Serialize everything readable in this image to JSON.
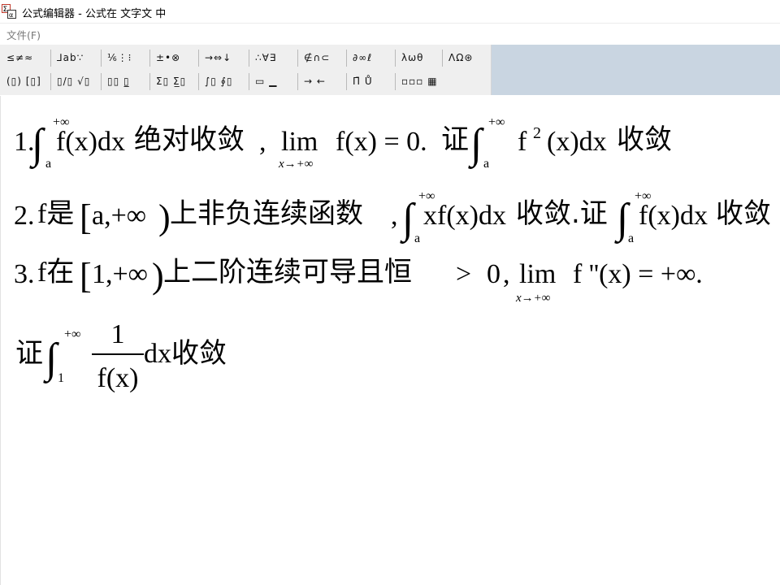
{
  "window": {
    "title": "公式编辑器 - 公式在 文字文 中"
  },
  "menu": {
    "file_label": "文件(F)"
  },
  "toolbar": {
    "row1": [
      {
        "name": "relations-palette-button",
        "label": "≤≠≈"
      },
      {
        "name": "spaces-palette-button",
        "label": "⅃ab∵"
      },
      {
        "name": "embellishments-palette-button",
        "label": "⅙⋮⁝"
      },
      {
        "name": "operators-palette-button",
        "label": "±•⊗"
      },
      {
        "name": "arrows-palette-button",
        "label": "→⇔↓"
      },
      {
        "name": "logic-palette-button",
        "label": "∴∀∃"
      },
      {
        "name": "sets-palette-button",
        "label": "∉∩⊂"
      },
      {
        "name": "misc-symbols-palette-button",
        "label": "∂∞ℓ"
      },
      {
        "name": "greek-lower-palette-button",
        "label": "λωθ"
      },
      {
        "name": "greek-upper-palette-button",
        "label": "ΛΩ⊛"
      }
    ],
    "row2": [
      {
        "name": "fences-template-button",
        "label": "(▯) [▯]"
      },
      {
        "name": "fraction-radical-template-button",
        "label": "▯/▯ √▯"
      },
      {
        "name": "subscript-template-button",
        "label": "▯▯ ▯̲"
      },
      {
        "name": "summation-template-button",
        "label": "Σ▯ Σ̲▯"
      },
      {
        "name": "integral-template-button",
        "label": "∫▯ ∮▯"
      },
      {
        "name": "underbar-template-button",
        "label": "▭ ▁"
      },
      {
        "name": "labeled-arrow-template-button",
        "label": "→ ←"
      },
      {
        "name": "products-template-button",
        "label": "Π̄ Ů"
      },
      {
        "name": "matrix-template-button",
        "label": "▫▫▫ ▦"
      }
    ]
  },
  "formula": {
    "line1": {
      "num": "1.",
      "int_upper": "+∞",
      "int_lower": "a",
      "integrand": "f(x)dx",
      "text1": "绝对收敛",
      "comma": ",",
      "lim": "lim",
      "lim_sub": "x→+∞",
      "lim_expr": "f(x) = 0.",
      "prove": "证",
      "int2_upper": "+∞",
      "int2_lower": "a",
      "f": "f",
      "sq": "2",
      "integrand2": "(x)dx",
      "text2": "收敛"
    },
    "line2": {
      "num": "2.",
      "text1": "f是",
      "bracket": "[",
      "interval": "a,+∞",
      "paren": ")",
      "text2": "上非负连续函数",
      "comma": ",",
      "int_upper": "+∞",
      "int_lower": "a",
      "integrand": "xf(x)dx",
      "text3": "收敛.证",
      "int2_upper": "+∞",
      "int2_lower": "a",
      "integrand2": "f(x)dx",
      "text4": "收敛"
    },
    "line3": {
      "num": "3.",
      "text1": "f在",
      "bracket": "[",
      "interval": "1,+∞",
      "paren": ")",
      "text2": "上二阶连续可导且恒",
      "gt": ">",
      "zero": "0",
      "comma": ",",
      "lim": "lim",
      "lim_sub": "x→+∞",
      "lim_expr": "f ''(x) = +∞."
    },
    "line4": {
      "prove": "证",
      "int_upper": "+∞",
      "int_lower": "1",
      "numerator": "1",
      "denominator": "f(x)",
      "after": "dx收敛"
    }
  }
}
